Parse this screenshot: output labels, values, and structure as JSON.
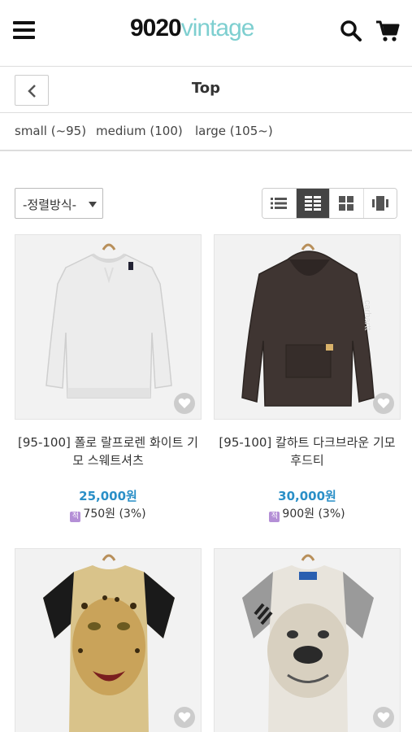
{
  "header": {
    "logo_number": "9020",
    "logo_word": "vintage",
    "logo_number_color": "#111111",
    "logo_word_color": "#7ecfd0"
  },
  "subheader": {
    "title": "Top"
  },
  "sizes": [
    "small (~95)",
    "medium (100)",
    "large (105~)"
  ],
  "sort": {
    "label": "-정렬방식-"
  },
  "view_modes": [
    {
      "icon": "list-view-icon",
      "active": false
    },
    {
      "icon": "grid-2-view-icon",
      "active": true
    },
    {
      "icon": "grid-4-view-icon",
      "active": false
    },
    {
      "icon": "gallery-view-icon",
      "active": false
    }
  ],
  "accent_price_color": "#2a8fc7",
  "points_badge_color": "#b48fd6",
  "points_badge_text": "적",
  "products": [
    {
      "name": "[95-100] 폴로 랄프로렌 화이트 기모 스웨트셔츠",
      "price": "25,000원",
      "points": "750원 (3%)"
    },
    {
      "name": "[95-100] 칼하트 다크브라운 기모 후드티",
      "price": "30,000원",
      "points": "900원 (3%)"
    },
    {
      "name": "",
      "price": "",
      "points": ""
    },
    {
      "name": "",
      "price": "",
      "points": ""
    }
  ]
}
